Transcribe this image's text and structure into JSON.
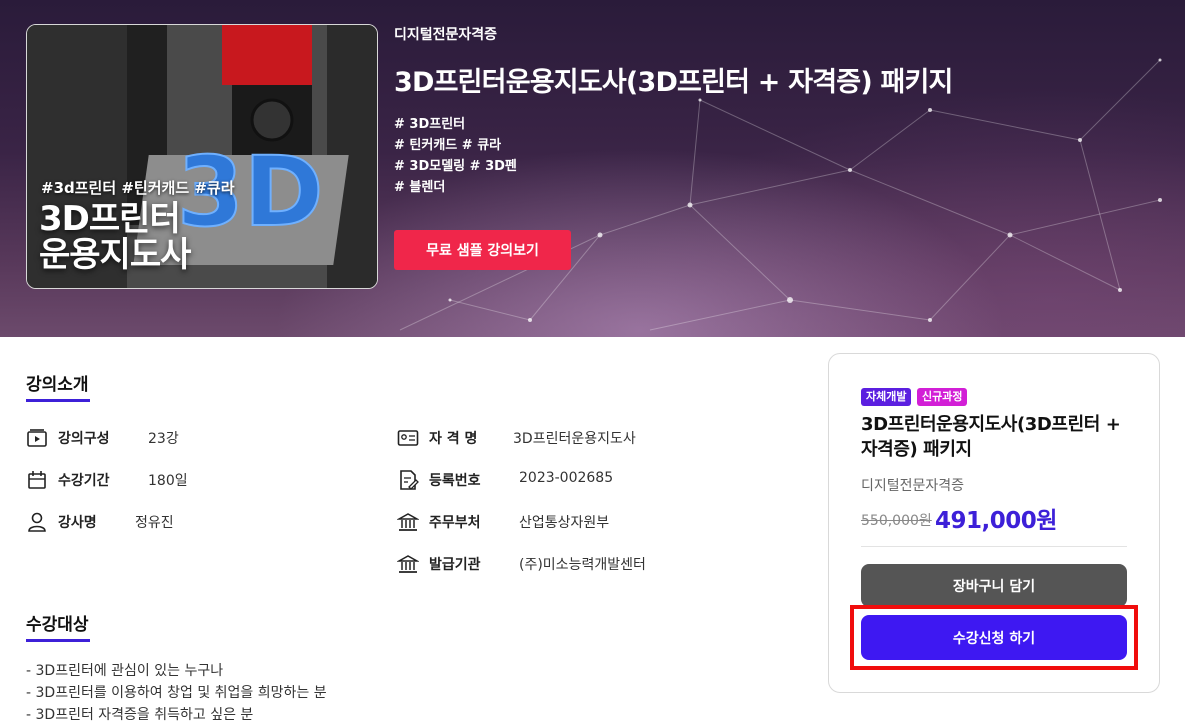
{
  "hero": {
    "category": "디지털전문자격증",
    "title": "3D프린터운용지도사(3D프린터 + 자격증) 패키지",
    "hashtags": [
      "# 3D프린터",
      "# 틴커캐드 # 큐라",
      "# 3D모델링 # 3D펜",
      "# 블렌더"
    ],
    "sample_button": "무료 샘플 강의보기",
    "thumbnail": {
      "tags": "#3d프린터 #틴커캐드 #큐라",
      "title_line1": "3D프린터",
      "title_line2": "운용지도사",
      "art_text": "3D"
    }
  },
  "intro": {
    "title": "강의소개",
    "left": [
      {
        "icon": "video-play-icon",
        "label": "강의구성",
        "value": "23강"
      },
      {
        "icon": "calendar-icon",
        "label": "수강기간",
        "value": "180일"
      },
      {
        "icon": "person-icon",
        "label": "강사명",
        "value": "정유진"
      }
    ],
    "right": [
      {
        "icon": "id-card-icon",
        "label": "자 격 명",
        "value": "3D프린터운용지도사"
      },
      {
        "icon": "document-edit-icon",
        "label": "등록번호",
        "value": "2023-002685"
      },
      {
        "icon": "institution-icon",
        "label": "주무부처",
        "value": "산업통상자원부"
      },
      {
        "icon": "institution-icon",
        "label": "발급기관",
        "value": "(주)미소능력개발센터"
      }
    ]
  },
  "target": {
    "title": "수강대상",
    "items": [
      "- 3D프린터에 관심이 있는 누구나",
      "- 3D프린터를 이용하여 창업 및 취업을 희망하는 분",
      "- 3D프린터 자격증을 취득하고 싶은 분"
    ]
  },
  "card": {
    "badges": [
      {
        "label": "자체개발",
        "color": "#5b1fe0"
      },
      {
        "label": "신규과정",
        "color": "#d21fd6"
      }
    ],
    "title": "3D프린터운용지도사(3D프린터 + 자격증) 패키지",
    "category": "디지털전문자격증",
    "price_original": "550,000원",
    "price_sale": "491,000원",
    "cart_button": "장바구니 담기",
    "enroll_button": "수강신청 하기"
  },
  "colors": {
    "accent": "#3e18f2",
    "sample_button": "#f0264a",
    "highlight": "#f00d0d"
  }
}
